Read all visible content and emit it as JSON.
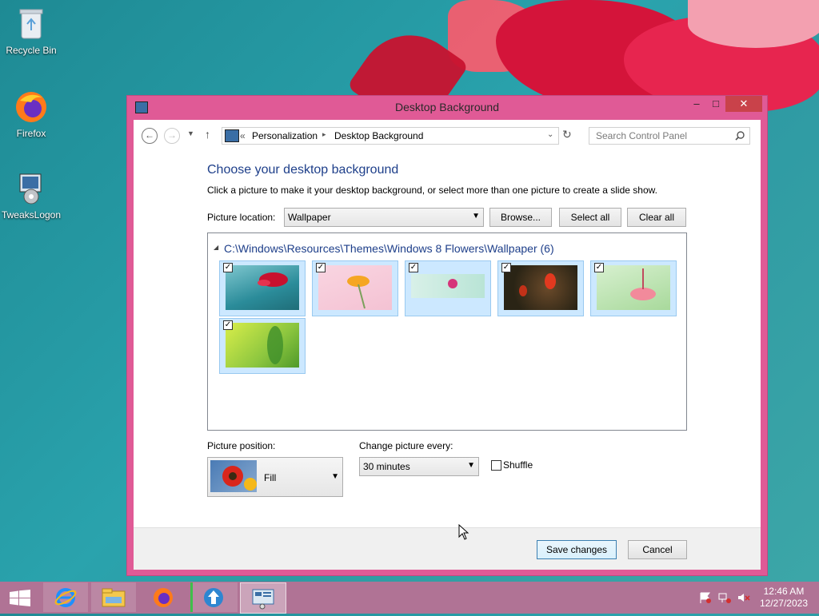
{
  "desktop": {
    "icons": [
      {
        "label": "Recycle Bin",
        "icon": "recycle-bin-icon"
      },
      {
        "label": "Firefox",
        "icon": "firefox-icon"
      },
      {
        "label": "TweaksLogon",
        "icon": "tweakslogon-icon"
      }
    ]
  },
  "window": {
    "title": "Desktop Background",
    "controls": {
      "minimize": "–",
      "maximize": "□",
      "close": "✕"
    }
  },
  "navbar": {
    "back": "←",
    "forward": "→",
    "up": "↑",
    "breadcrumb_prefix": "«",
    "breadcrumb": [
      "Personalization",
      "Desktop Background"
    ],
    "separator": "▸",
    "refresh": "↻",
    "search_placeholder": "Search Control Panel"
  },
  "main": {
    "heading": "Choose your desktop background",
    "description": "Click a picture to make it your desktop background, or select more than one picture to create a slide show.",
    "picture_location_label": "Picture location:",
    "picture_location_value": "Wallpaper",
    "browse": "Browse...",
    "select_all": "Select all",
    "clear_all": "Clear all",
    "folder": "C:\\Windows\\Resources\\Themes\\Windows 8 Flowers\\Wallpaper (6)",
    "thumbnails": [
      {
        "name": "Red flower on teal",
        "checked": true
      },
      {
        "name": "Orange flower on pink",
        "checked": true
      },
      {
        "name": "Pink flower on mint",
        "checked": true
      },
      {
        "name": "Red tulips dark",
        "checked": true
      },
      {
        "name": "Pink flower on green",
        "checked": true
      },
      {
        "name": "Green leaf",
        "checked": true
      }
    ],
    "picture_position_label": "Picture position:",
    "picture_position_value": "Fill",
    "change_every_label": "Change picture every:",
    "change_every_value": "30 minutes",
    "shuffle_label": "Shuffle",
    "shuffle_checked": false
  },
  "footer": {
    "save": "Save changes",
    "cancel": "Cancel"
  },
  "taskbar": {
    "apps": [
      "start",
      "internet-explorer",
      "file-explorer",
      "firefox",
      "tweakslogon",
      "control-panel"
    ],
    "time": "12:46 AM",
    "date": "12/27/2023"
  }
}
